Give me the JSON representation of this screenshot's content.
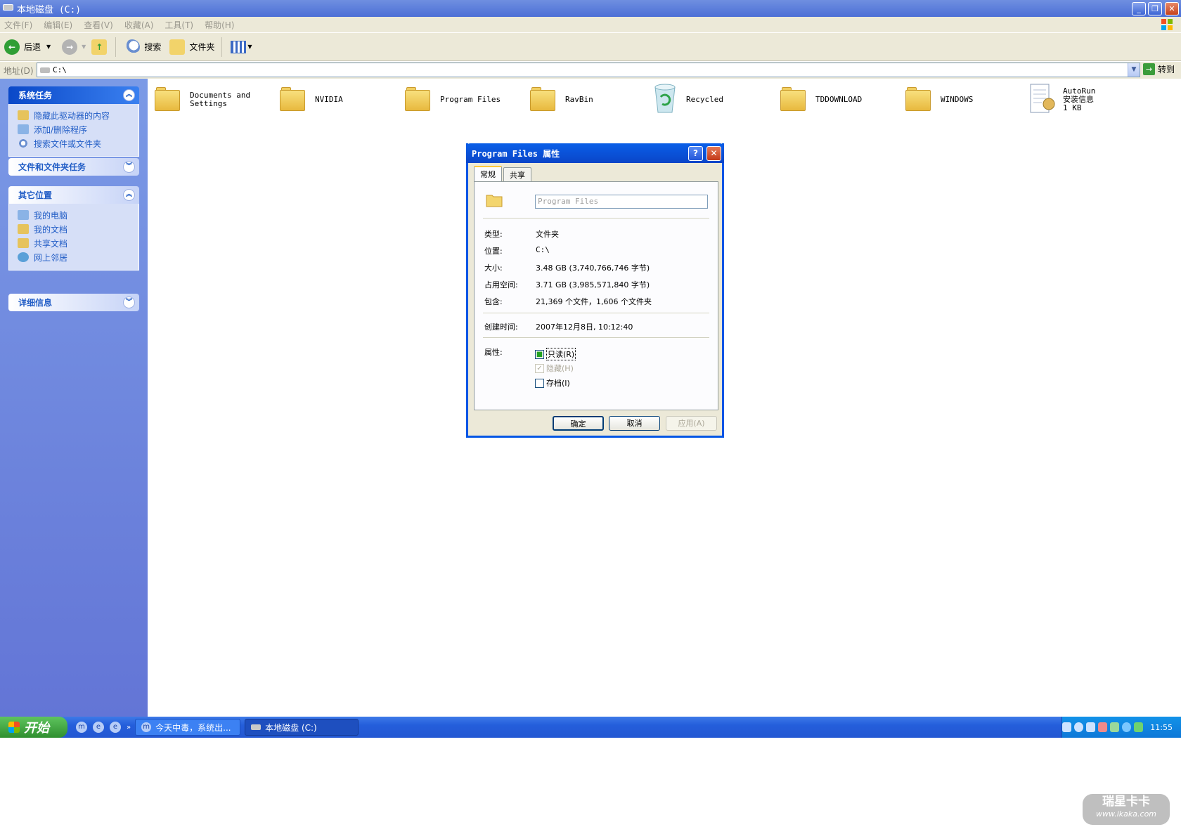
{
  "window": {
    "title": "本地磁盘 (C:)"
  },
  "menu": [
    "文件(F)",
    "编辑(E)",
    "查看(V)",
    "收藏(A)",
    "工具(T)",
    "帮助(H)"
  ],
  "toolbar": {
    "back": "后退",
    "search": "搜索",
    "folders": "文件夹"
  },
  "address": {
    "label": "地址(D)",
    "value": "C:\\",
    "go": "转到"
  },
  "left_panels": {
    "system_tasks": {
      "title": "系统任务",
      "items": [
        "隐藏此驱动器的内容",
        "添加/删除程序",
        "搜索文件或文件夹"
      ]
    },
    "file_tasks": {
      "title": "文件和文件夹任务"
    },
    "other_places": {
      "title": "其它位置",
      "items": [
        "我的电脑",
        "我的文档",
        "共享文档",
        "网上邻居"
      ]
    },
    "details": {
      "title": "详细信息"
    }
  },
  "files": [
    {
      "name": "Documents and\nSettings"
    },
    {
      "name": "NVIDIA"
    },
    {
      "name": "Program Files"
    },
    {
      "name": "RavBin"
    },
    {
      "name": "Recycled"
    },
    {
      "name": "TDDOWNLOAD"
    },
    {
      "name": "WINDOWS"
    },
    {
      "name": "AutoRun\n安装信息\n1 KB"
    }
  ],
  "dialog": {
    "title": "Program Files 属性",
    "tabs": [
      "常规",
      "共享"
    ],
    "name_value": "Program Files",
    "type_label": "类型:",
    "type_value": "文件夹",
    "location_label": "位置:",
    "location_value": "C:\\",
    "size_label": "大小:",
    "size_value": "3.48 GB (3,740,766,746 字节)",
    "disk_label": "占用空间:",
    "disk_value": "3.71 GB (3,985,571,840 字节)",
    "contains_label": "包含:",
    "contains_value": "21,369 个文件，1,606 个文件夹",
    "created_label": "创建时间:",
    "created_value": "2007年12月8日, 10:12:40",
    "attr_label": "属性:",
    "readonly": "只读(R)",
    "hidden": "隐藏(H)",
    "archive": "存档(I)",
    "ok": "确定",
    "cancel": "取消",
    "apply": "应用(A)"
  },
  "taskbar": {
    "start": "开始",
    "tasks": [
      "今天中毒，系统出...",
      "本地磁盘 (C:)"
    ],
    "time": "11:55"
  },
  "watermark": {
    "line1": "瑞星卡卡",
    "line2": "www.ikaka.com"
  }
}
